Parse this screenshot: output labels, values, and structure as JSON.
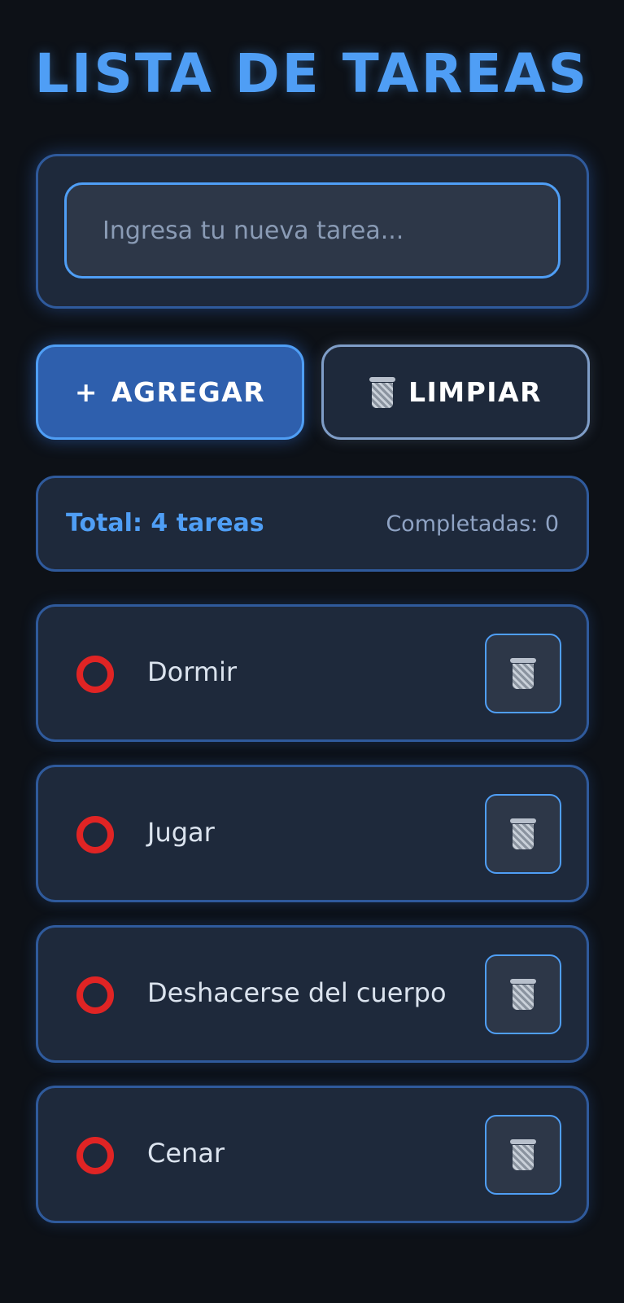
{
  "app": {
    "title": "LISTA DE TAREAS"
  },
  "input": {
    "placeholder": "Ingresa tu nueva tarea...",
    "value": ""
  },
  "actions": {
    "add": {
      "icon": "plus-icon",
      "glyph": "+",
      "label": "AGREGAR"
    },
    "clear": {
      "icon": "trash-icon",
      "label": "LIMPIAR"
    }
  },
  "stats": {
    "total": "Total: 4 tareas",
    "completed": "Completadas: 0"
  },
  "tasks": [
    {
      "text": "Dormir",
      "completed": false,
      "status_icon": "red-circle-icon",
      "delete_icon": "trash-icon"
    },
    {
      "text": "Jugar",
      "completed": false,
      "status_icon": "red-circle-icon",
      "delete_icon": "trash-icon"
    },
    {
      "text": "Deshacerse del cuerpo",
      "completed": false,
      "status_icon": "red-circle-icon",
      "delete_icon": "trash-icon"
    },
    {
      "text": "Cenar",
      "completed": false,
      "status_icon": "red-circle-icon",
      "delete_icon": "trash-icon"
    }
  ],
  "colors": {
    "background": "#0d1117",
    "accent": "#4f9ef5",
    "card": "#1e293b",
    "card_border": "#2f5a9c",
    "pending_circle": "#e02424"
  }
}
